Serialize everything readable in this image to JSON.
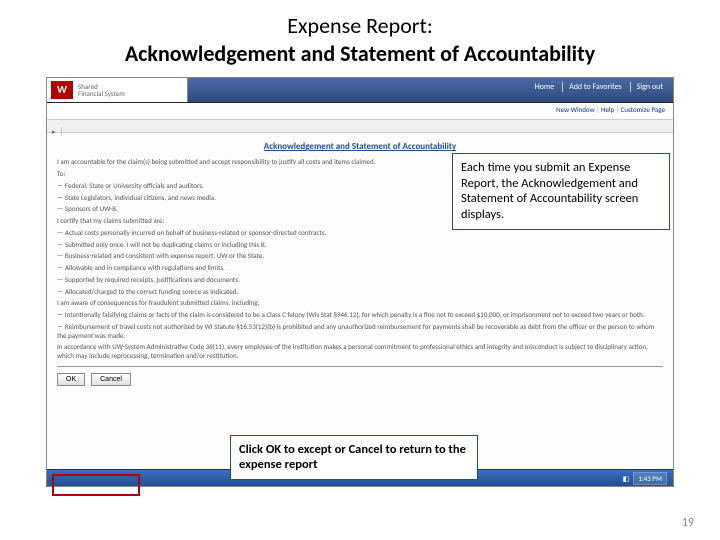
{
  "slide": {
    "title_line1": "Expense Report:",
    "title_line2": "Acknowledgement and Statement of Accountability",
    "page_number": "19"
  },
  "header": {
    "logo_initial": "W",
    "logo_text_top": "Shared",
    "logo_text_bottom": "Financial System",
    "links": {
      "home": "Home",
      "worklist": "Add to Favorites",
      "signout": "Sign out"
    }
  },
  "subheader": {
    "window": "New Window",
    "help": "Help",
    "custom": "Customize Page"
  },
  "content": {
    "section_title": "Acknowledgement and Statement of Accountability",
    "intro": "I am accountable for the claim(s) being submitted and accept responsibility to justify all costs and items claimed.",
    "intro2": "To:",
    "bullets_a": [
      "Federal, State or University officials and auditors.",
      "State Legislators, individual citizens, and news media.",
      "Sponsors of UW-B."
    ],
    "certify": "I certify that my claims submitted are:",
    "bullets_b": [
      "Actual costs personally incurred on behalf of business-related or sponsor-directed contracts.",
      "Submitted only once. I will not be duplicating claims or including this B.",
      "Business-related and consistent with expense report, UW or the State.",
      "Allowable and in compliance with regulations and limits.",
      "Supported by required receipts, justifications and documents.",
      "Allocated/charged to the correct funding source as indicated."
    ],
    "aware": "I am aware of consequences for fraudulent submitted claims, including:",
    "dash1": "Intentionally falsifying claims or facts of the claim is considered to be a Class C felony (Wis Stat §946.12), for which penalty is a fine not to exceed $10,000, or imprisonment not to exceed two years or both.",
    "dash2": "Reimbursement of travel costs not authorized by WI Statute §16.53(12)(b) is prohibited and any unauthorized reimbursement for payments shall be recoverable as debt from the officer or the person to whom the payment was made.",
    "para3": "In accordance with UW-System Administrative Code 36(11), every employee of the institution makes a personal commitment to professional ethics and integrity and misconduct is subject to disciplinary action, which may include reprocessing, termination and/or restitution.",
    "buttons": {
      "ok": "OK",
      "cancel": "Cancel"
    }
  },
  "callouts": {
    "right_box": "Each time you submit an Expense Report, the Acknowledgement and Statement of Accountability screen displays.",
    "bottom_box": "Click OK to except or Cancel to return to the expense report"
  },
  "taskbar": {
    "start": " ",
    "time": "1:43 PM"
  }
}
